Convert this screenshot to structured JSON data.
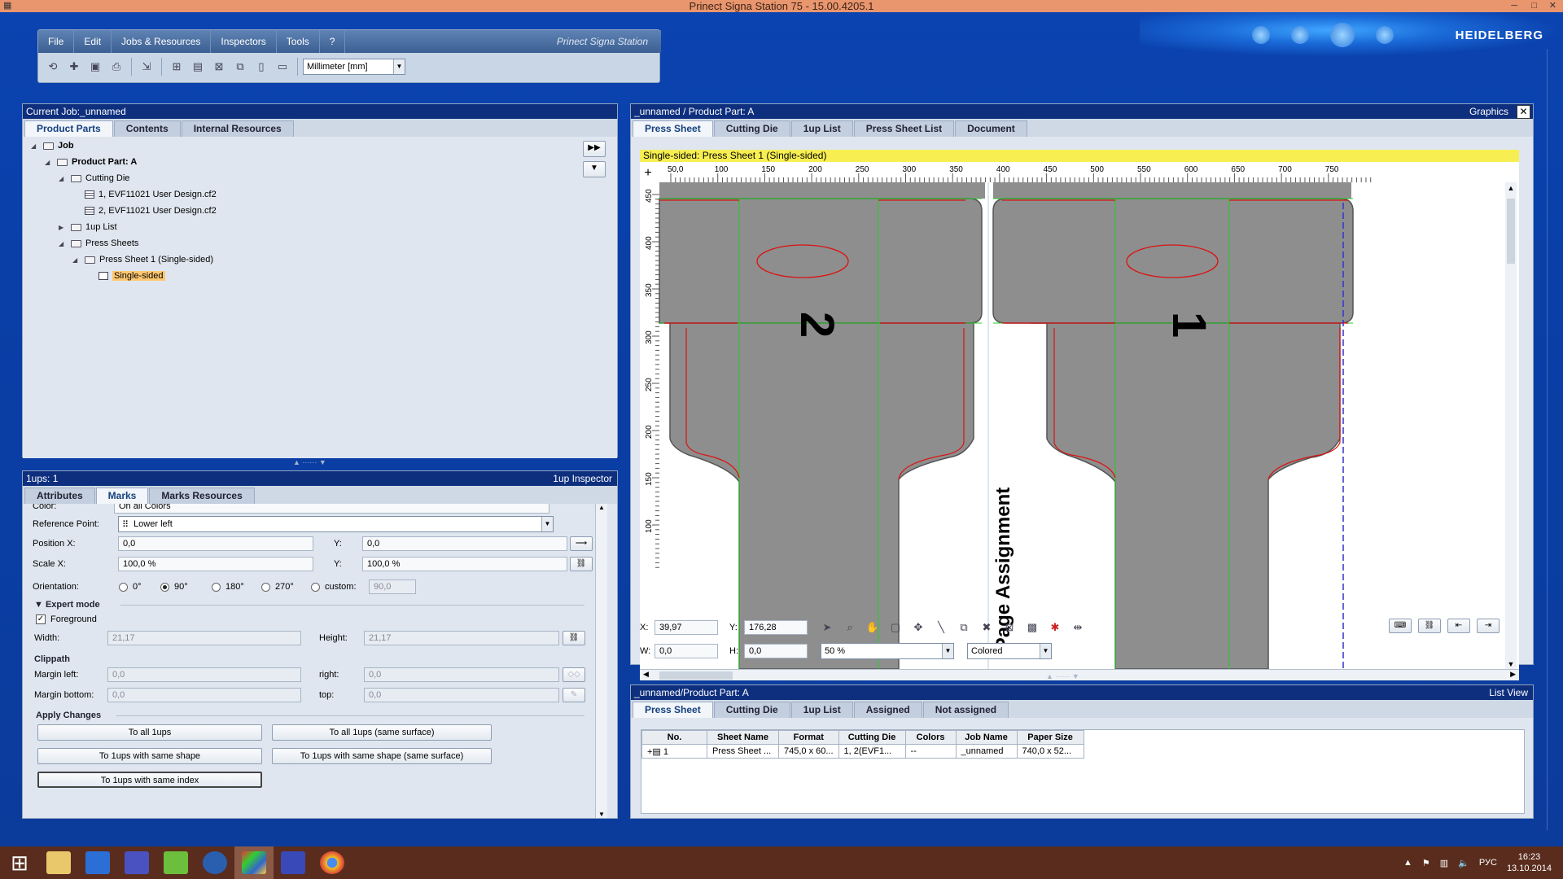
{
  "window": {
    "title": "Prinect Signa Station 75  -  15.00.4205.1"
  },
  "brand": {
    "logo": "HEIDELBERG",
    "product": "Prinect Signa Station"
  },
  "menu": {
    "items": [
      "File",
      "Edit",
      "Jobs & Resources",
      "Inspectors",
      "Tools",
      "?"
    ]
  },
  "toolbar": {
    "unit": "Millimeter  [mm]"
  },
  "job_panel": {
    "header": "Current Job:_unnamed",
    "tabs": [
      "Product Parts",
      "Contents",
      "Internal Resources"
    ],
    "tree": {
      "job": "Job",
      "product_part": "Product Part: A",
      "cutting_die": "Cutting Die",
      "file1": "1, EVF11021 User Design.cf2",
      "file2": "2, EVF11021 User Design.cf2",
      "oneup_list": "1up List",
      "press_sheets": "Press Sheets",
      "press_sheet_1": "Press Sheet 1 (Single-sided)",
      "single_sided": "Single-sided"
    }
  },
  "inspector": {
    "header_left": "1ups:  1",
    "header_right": "1up Inspector",
    "tabs": [
      "Attributes",
      "Marks",
      "Marks Resources"
    ],
    "color_label": "Color:",
    "color_value": "On all Colors",
    "ref_point_label": "Reference Point:",
    "ref_point_value": "Lower left",
    "pos_x_label": "Position X:",
    "pos_x": "0,0",
    "pos_y_label": "Y:",
    "pos_y": "0,0",
    "scale_x_label": "Scale X:",
    "scale_x": "100,0 %",
    "scale_y_label": "Y:",
    "scale_y": "100,0 %",
    "orientation_label": "Orientation:",
    "orientations": [
      "0°",
      "90°",
      "180°",
      "270°",
      "custom:"
    ],
    "custom_value": "90,0",
    "expert_mode": "Expert mode",
    "foreground": "Foreground",
    "width_label": "Width:",
    "width": "21,17",
    "height_label": "Height:",
    "height": "21,17",
    "clippath": "Clippath",
    "margin_left_label": "Margin left:",
    "margin_left": "0,0",
    "right_label": "right:",
    "right": "0,0",
    "margin_bottom_label": "Margin bottom:",
    "margin_bottom": "0,0",
    "top_label": "top:",
    "top": "0,0",
    "apply_changes": "Apply Changes",
    "buttons": [
      "To all 1ups",
      "To all 1ups (same surface)",
      "To 1ups with same shape",
      "To 1ups with same shape (same surface)",
      "To 1ups with same index"
    ]
  },
  "graphics": {
    "header_left": "_unnamed / Product Part: A",
    "header_right": "Graphics",
    "tabs": [
      "Press Sheet",
      "Cutting Die",
      "1up List",
      "Press Sheet List",
      "Document"
    ],
    "banner": "Single-sided:  Press Sheet 1 (Single-sided)",
    "ruler_x": [
      "50,0",
      "100",
      "150",
      "200",
      "250",
      "300",
      "350",
      "400",
      "450",
      "500",
      "550",
      "600",
      "650",
      "700",
      "750"
    ],
    "ruler_y": [
      "450",
      "400",
      "350",
      "300",
      "250",
      "200",
      "150",
      "100"
    ],
    "page_label": "Page Assignment",
    "num_left": "2",
    "num_right": "1",
    "x_label": "X:",
    "x": "39,97",
    "y_label": "Y:",
    "y": "176,28",
    "w_label": "W:",
    "w": "0,0",
    "h_label": "H:",
    "h": "0,0",
    "zoom": "50 %",
    "mode": "Colored"
  },
  "listview": {
    "header_left": "_unnamed/Product Part: A",
    "header_right": "List View",
    "tabs": [
      "Press Sheet",
      "Cutting Die",
      "1up List",
      "Assigned",
      "Not assigned"
    ],
    "columns": [
      "No.",
      "Sheet Name",
      "Format",
      "Cutting Die",
      "Colors",
      "Job Name",
      "Paper Size"
    ],
    "rows": [
      [
        "1",
        "Press Sheet ...",
        "745,0 x 60...",
        "1, 2(EVF1...",
        "--",
        "_unnamed",
        "740,0 x 52..."
      ]
    ]
  },
  "taskbar": {
    "lang": "РУС",
    "time": "16:23",
    "date": "13.10.2014"
  },
  "colors": {
    "accent": "#0e2f7e",
    "die_fill": "#8e8e8e",
    "cut_line": "#d11",
    "grid_line": "#2c2",
    "banner": "#f7ef52"
  }
}
